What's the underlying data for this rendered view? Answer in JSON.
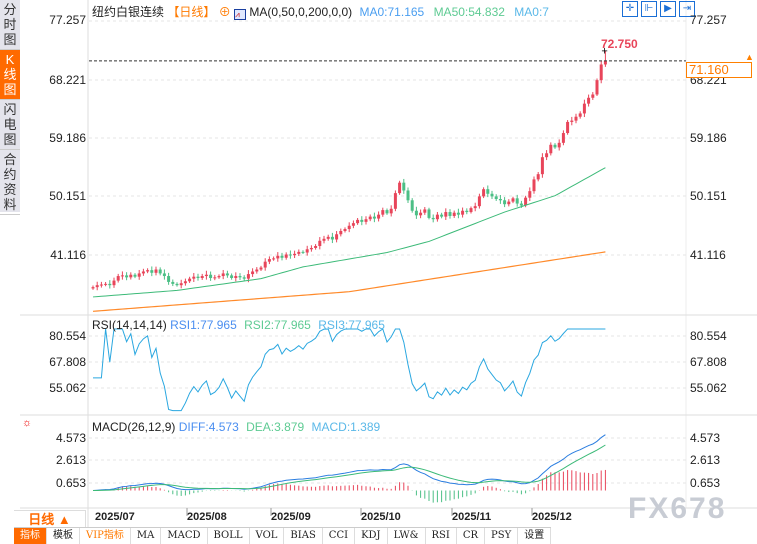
{
  "left_tabs": [
    {
      "label": "分时图"
    },
    {
      "label": "K线图",
      "active": true
    },
    {
      "label": "闪电图"
    },
    {
      "label": "合约资料"
    }
  ],
  "header": {
    "title": "纽约白银连续",
    "period_tag": "【日线】",
    "ma_label": "MA(0,50,0,200,0,0)",
    "ma0": "MA0:71.165",
    "ma50": "MA50:54.832",
    "ma0b": "MA0:7"
  },
  "toolbar_icons": [
    "crosshair-icon",
    "fit-range-icon",
    "play-range-icon",
    "exit-range-icon"
  ],
  "price_axis": {
    "left": [
      "77.257",
      "68.221",
      "59.186",
      "50.151",
      "41.116"
    ],
    "right": [
      "77.257",
      "68.221",
      "59.186",
      "50.151",
      "41.116"
    ]
  },
  "high_label": "72.750",
  "current_price": "71.160",
  "rsi": {
    "label": "RSI(14,14,14)",
    "rsi1": "RSI1:77.965",
    "rsi2": "RSI2:77.965",
    "rsi3": "RSI3:77.965",
    "axis": [
      "80.554",
      "67.808",
      "55.062"
    ]
  },
  "macd": {
    "label": "MACD(26,12,9)",
    "diff": "DIFF:4.573",
    "dea": "DEA:3.879",
    "macd": "MACD:1.389",
    "axis": [
      "4.573",
      "2.613",
      "0.653"
    ]
  },
  "period_selector": "日线 ▲",
  "date_labels": [
    "2025/07",
    "2025/08",
    "2025/09",
    "2025/10",
    "2025/11",
    "2025/12"
  ],
  "bottom_tabs": [
    {
      "label": "指标",
      "active": true
    },
    {
      "label": "模板"
    },
    {
      "label": "VIP指标",
      "vip": true
    },
    {
      "label": "MA"
    },
    {
      "label": "MACD"
    },
    {
      "label": "BOLL"
    },
    {
      "label": "VOL"
    },
    {
      "label": "BIAS"
    },
    {
      "label": "CCI"
    },
    {
      "label": "KDJ"
    },
    {
      "label": "LW&"
    },
    {
      "label": "RSI"
    },
    {
      "label": "CR"
    },
    {
      "label": "PSY"
    },
    {
      "label": "设置"
    }
  ],
  "watermark": "FX678",
  "colors": {
    "up": "#e8455a",
    "down": "#4cbf86",
    "ma50": "#3cba78",
    "ma200": "#ff8a2a",
    "rsi": "#2aa7e0",
    "diff": "#2a7de0",
    "dea": "#3cba78",
    "accent": "#ff6a00"
  },
  "chart_data": {
    "type": "candlestick",
    "closes": [
      36.5,
      36.8,
      36.9,
      37.0,
      36.8,
      37.5,
      38.2,
      38.3,
      38.0,
      38.4,
      38.1,
      38.6,
      38.9,
      39.1,
      38.7,
      39.2,
      38.6,
      38.2,
      37.3,
      37.0,
      36.8,
      37.1,
      37.4,
      37.8,
      38.1,
      37.9,
      38.2,
      38.4,
      37.9,
      38.0,
      38.2,
      38.6,
      38.3,
      37.9,
      38.2,
      38.0,
      37.8,
      38.5,
      38.9,
      39.2,
      39.5,
      40.4,
      40.8,
      40.9,
      41.3,
      41.0,
      41.5,
      41.4,
      41.6,
      41.9,
      41.8,
      42.3,
      42.5,
      42.8,
      43.6,
      43.9,
      44.2,
      43.8,
      44.6,
      45.1,
      45.4,
      45.9,
      46.3,
      46.8,
      46.5,
      46.9,
      47.3,
      47.0,
      47.6,
      48.3,
      47.8,
      48.5,
      50.9,
      52.5,
      51.3,
      49.8,
      48.2,
      47.5,
      47.9,
      48.4,
      47.1,
      46.9,
      47.6,
      47.3,
      48.0,
      47.4,
      47.9,
      47.6,
      48.2,
      48.0,
      48.6,
      48.9,
      50.4,
      51.5,
      50.8,
      50.4,
      50.0,
      49.8,
      49.2,
      49.6,
      50.1,
      49.3,
      49.0,
      50.2,
      51.2,
      53.0,
      53.8,
      56.4,
      57.0,
      58.3,
      57.9,
      58.6,
      60.1,
      61.8,
      62.0,
      62.6,
      63.1,
      64.6,
      65.5,
      66.0,
      68.2,
      70.6,
      71.16
    ],
    "first_open": 36.3,
    "high": 72.75,
    "ma50": [
      [
        0,
        35.0
      ],
      [
        20,
        36.0
      ],
      [
        40,
        37.8
      ],
      [
        50,
        39.6
      ],
      [
        70,
        41.8
      ],
      [
        80,
        43.5
      ],
      [
        98,
        48.0
      ],
      [
        110,
        50.5
      ],
      [
        122,
        54.8
      ]
    ],
    "ma200": [
      [
        0,
        32.8
      ],
      [
        61,
        35.8
      ],
      [
        122,
        41.9
      ]
    ],
    "ylim": [
      31.5,
      77.257
    ]
  }
}
